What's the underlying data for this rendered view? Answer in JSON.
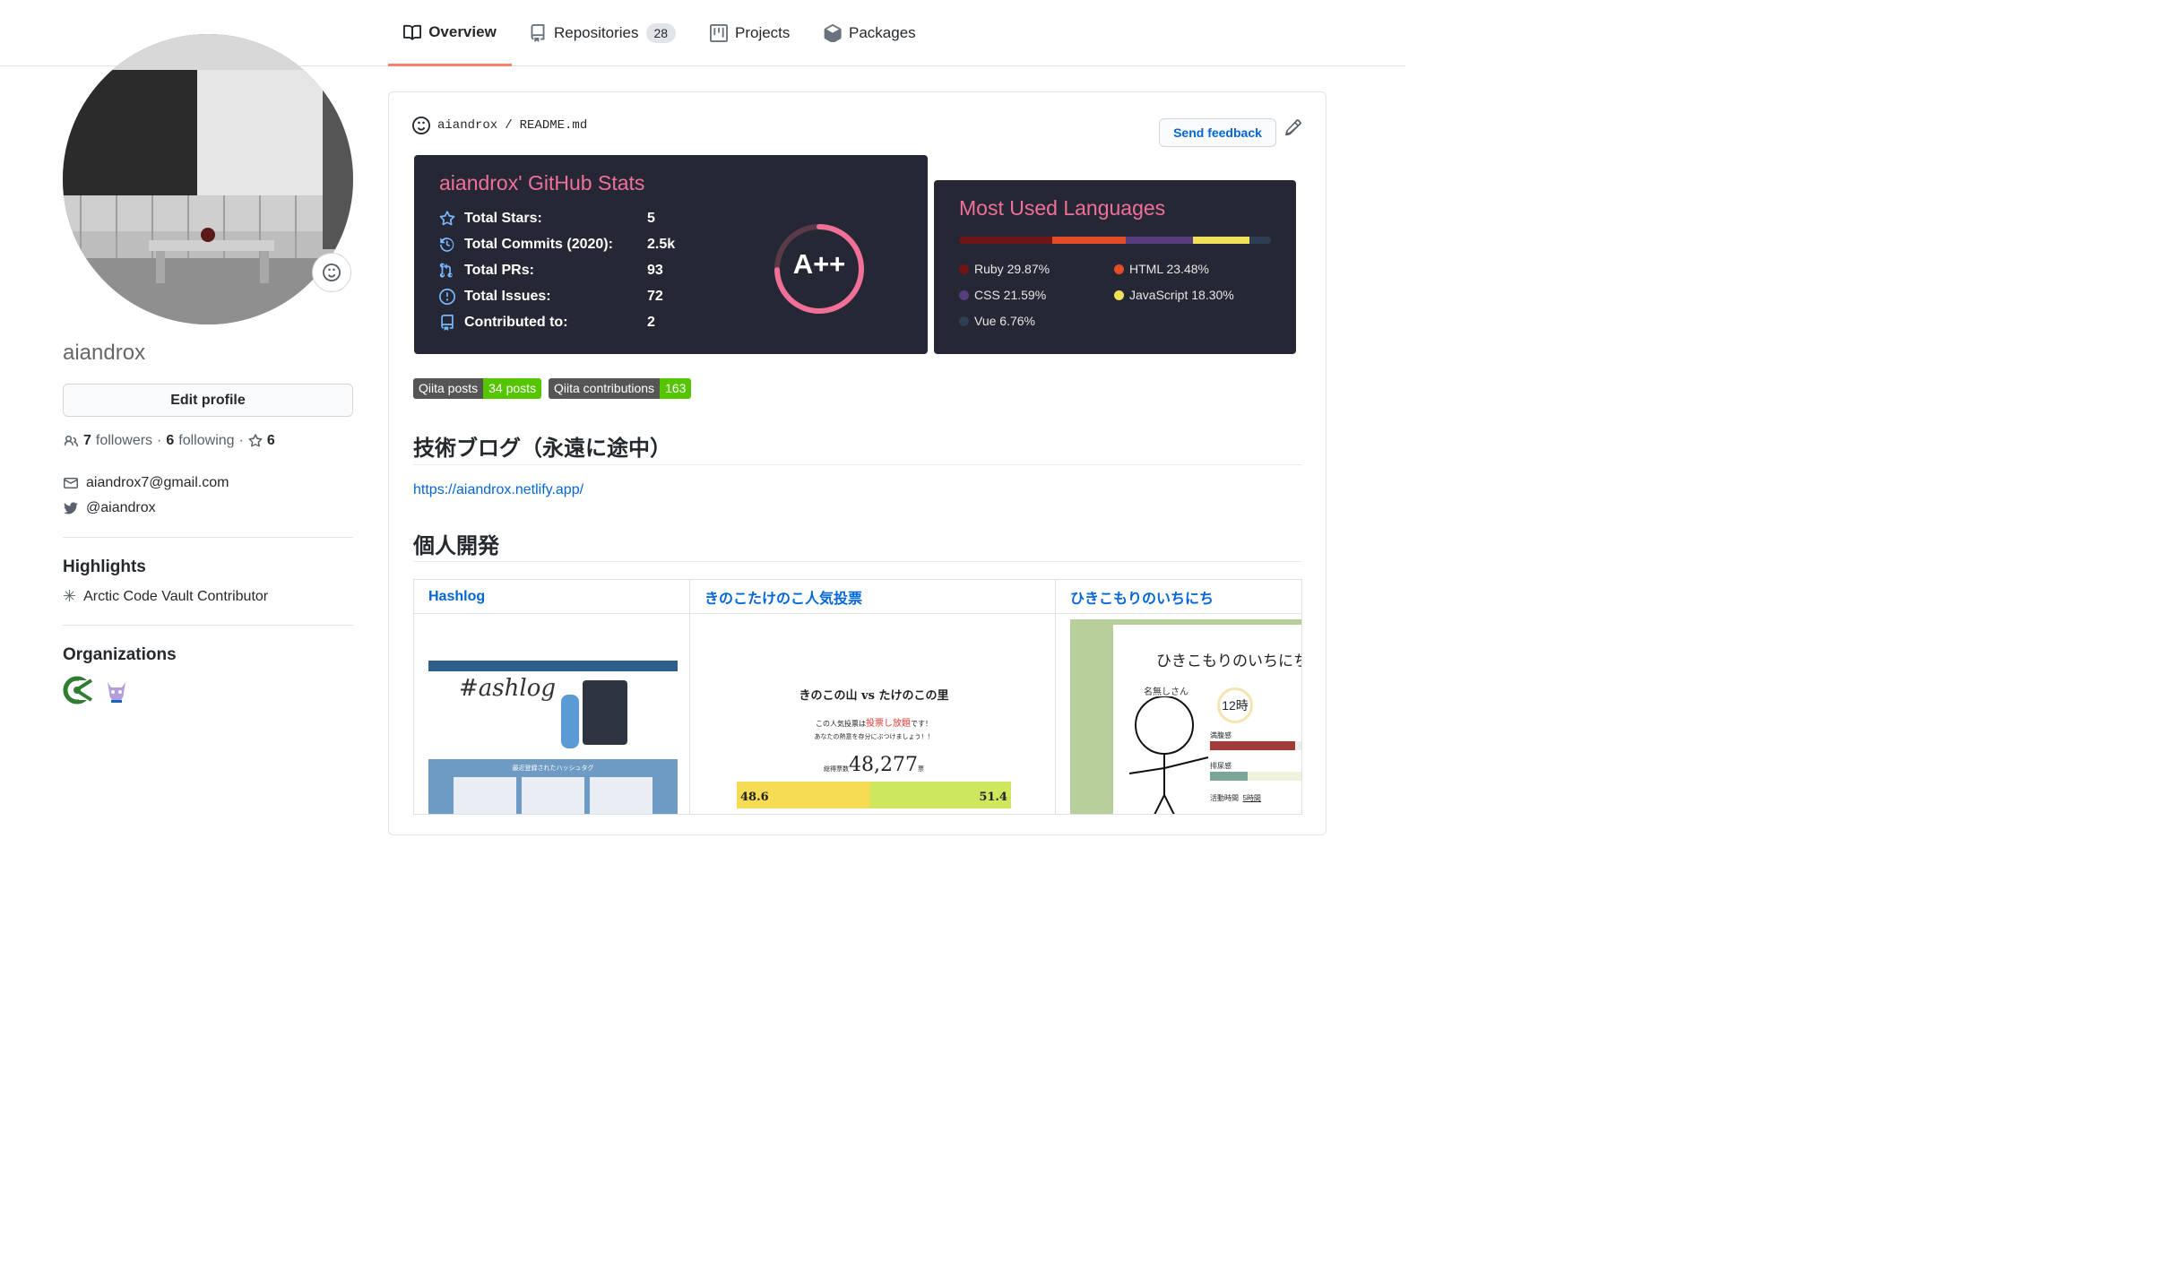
{
  "tabs": {
    "overview": "Overview",
    "repositories": "Repositories",
    "repo_count": "28",
    "projects": "Projects",
    "packages": "Packages"
  },
  "profile": {
    "username": "aiandrox",
    "edit_label": "Edit profile",
    "followers_count": "7",
    "followers_label": "followers",
    "following_count": "6",
    "following_label": "following",
    "stars_count": "6",
    "email": "aiandrox7@gmail.com",
    "twitter": "@aiandrox"
  },
  "highlights": {
    "title": "Highlights",
    "item": "Arctic Code Vault Contributor"
  },
  "organizations": {
    "title": "Organizations"
  },
  "readme": {
    "owner": "aiandrox",
    "file": "README.md",
    "feedback": "Send feedback"
  },
  "stats": {
    "title": "aiandrox' GitHub Stats",
    "rows": [
      {
        "label": "Total Stars:",
        "value": "5"
      },
      {
        "label": "Total Commits (2020):",
        "value": "2.5k"
      },
      {
        "label": "Total PRs:",
        "value": "93"
      },
      {
        "label": "Total Issues:",
        "value": "72"
      },
      {
        "label": "Contributed to:",
        "value": "2"
      }
    ],
    "grade": "A++"
  },
  "languages": {
    "title": "Most Used Languages",
    "items": [
      {
        "name": "Ruby 29.87%",
        "color": "#701516",
        "pct": 29.87
      },
      {
        "name": "HTML 23.48%",
        "color": "#e34c26",
        "pct": 23.48
      },
      {
        "name": "CSS 21.59%",
        "color": "#563d7c",
        "pct": 21.59
      },
      {
        "name": "JavaScript 18.30%",
        "color": "#f1e05a",
        "pct": 18.3
      },
      {
        "name": "Vue 6.76%",
        "color": "#2c3e50",
        "pct": 6.76
      }
    ]
  },
  "badges": [
    {
      "label": "Qiita posts",
      "value": "34 posts"
    },
    {
      "label": "Qiita contributions",
      "value": "163"
    }
  ],
  "blog": {
    "heading": "技術ブログ（永遠に途中）",
    "url": "https://aiandrox.netlify.app/"
  },
  "dev": {
    "heading": "個人開発",
    "projects": [
      "Hashlog",
      "きのこたけのこ人気投票",
      "ひきこもりのいちにち"
    ]
  },
  "shots": {
    "kinoko_title": "きのこの山 vs たけのこの里",
    "kinoko_sub1": "この人気投票は",
    "kinoko_sub2": "投票し放題",
    "kinoko_sub3": "です！",
    "kinoko_sub4": "あなたの熱意を存分にぶつけましょう！！",
    "kinoko_total_label": "総得票数",
    "kinoko_total": "48,277",
    "kinoko_unit": "票",
    "kinoko_left": "48.6",
    "kinoko_right": "51.4",
    "hiki_title": "ひきこもりのいちにち",
    "hiki_name": "名無しさん",
    "hiki_time": "12時",
    "hiki_m1": "満腹感",
    "hiki_m2": "排尿感",
    "hiki_m3": "活動時間",
    "hiki_m3v": "5時間",
    "hashlog_logo": "#ashlog",
    "hashlog_section": "最近登録されたハッシュタグ"
  }
}
